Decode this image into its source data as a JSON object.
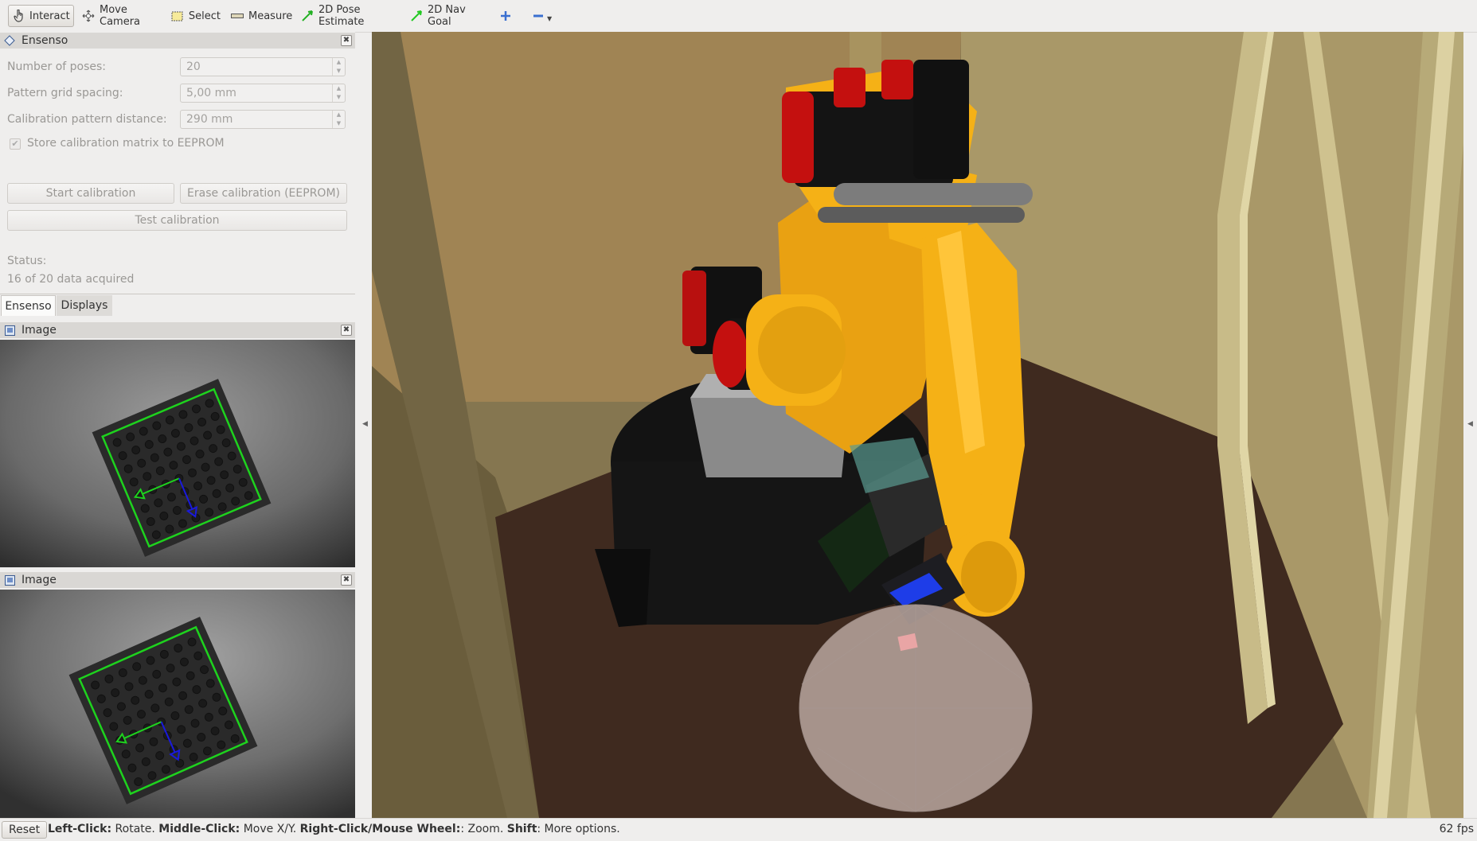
{
  "toolbar": {
    "interact": "Interact",
    "move_camera": "Move Camera",
    "select": "Select",
    "measure": "Measure",
    "pose_estimate": "2D Pose Estimate",
    "nav_goal": "2D Nav Goal"
  },
  "ensenso_panel": {
    "title": "Ensenso",
    "fields": [
      {
        "label": "Number of poses:",
        "value": "20"
      },
      {
        "label": "Pattern grid spacing:",
        "value": "5,00 mm"
      },
      {
        "label": "Calibration pattern distance:",
        "value": "290 mm"
      }
    ],
    "checkbox_label": "Store calibration matrix to EEPROM",
    "checkbox_checked": true,
    "start_button": "Start calibration",
    "erase_button": "Erase calibration (EEPROM)",
    "test_button": "Test calibration",
    "status_label": "Status:",
    "status_value": "16 of 20 data acquired"
  },
  "tabs": [
    "Ensenso",
    "Displays"
  ],
  "image_panels": [
    {
      "title": "Image"
    },
    {
      "title": "Image"
    }
  ],
  "statusbar": {
    "reset": "Reset",
    "hint_parts": [
      {
        "b": "Left-Click:",
        "t": " Rotate. "
      },
      {
        "b": "Middle-Click:",
        "t": " Move X/Y. "
      },
      {
        "b": "Right-Click/Mouse Wheel:",
        "t": ": Zoom. "
      },
      {
        "b": "Shift",
        "t": ": More options."
      }
    ],
    "fps": "62 fps"
  },
  "colors": {
    "robot_yellow": "#f5b116",
    "motor_red": "#c4100f",
    "floor": "#3f2a1f",
    "back_wall": "#a08454",
    "right_wall": "#a99868",
    "pattern_green": "#1ed21e",
    "axis_blue": "#1a1adc"
  }
}
